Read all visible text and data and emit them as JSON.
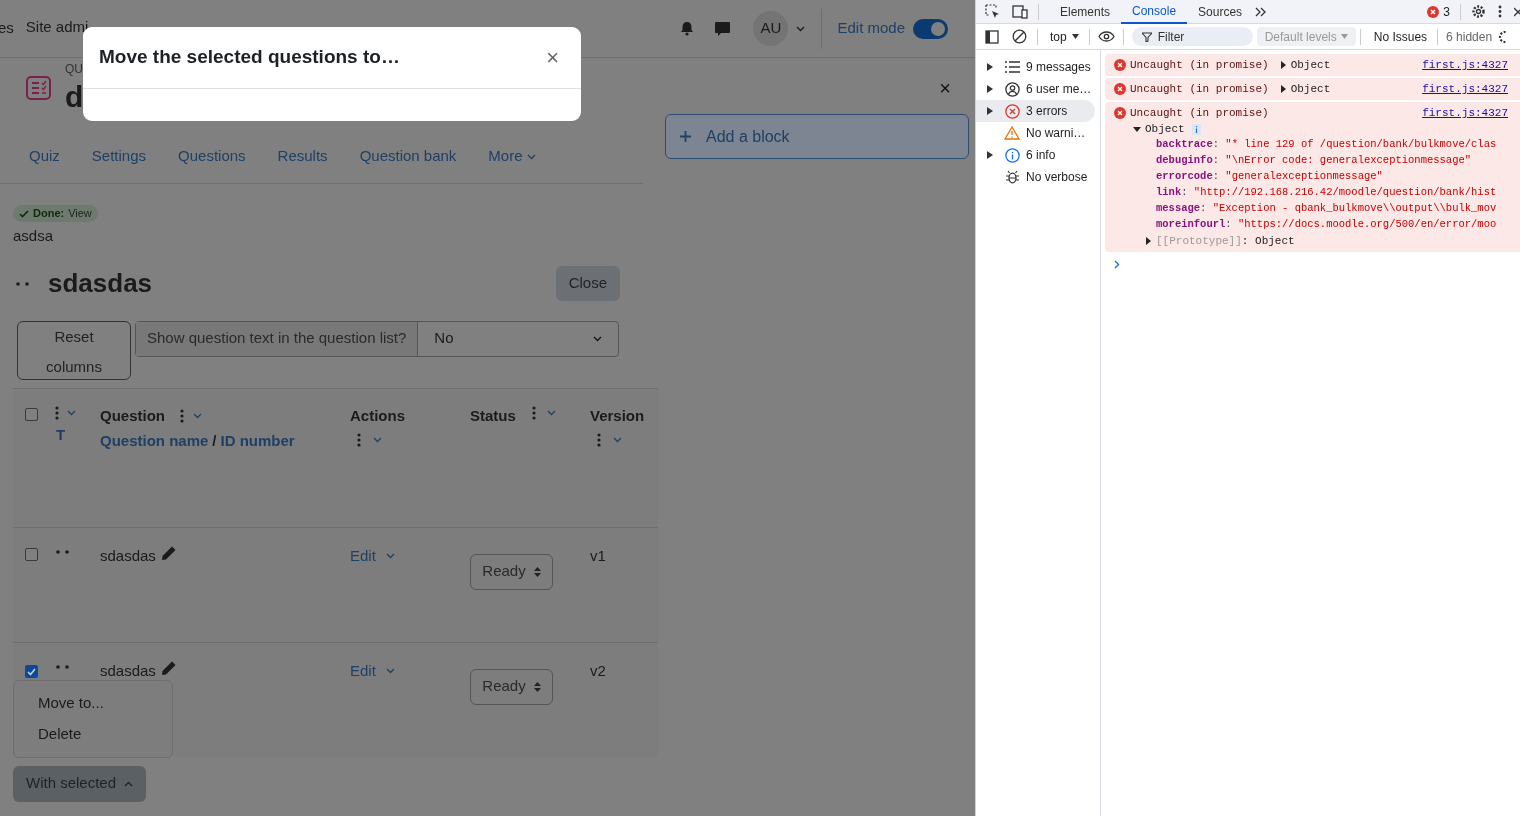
{
  "header": {
    "nav_items": [
      "es",
      "Site admi"
    ],
    "avatar": "AU",
    "edit_mode": {
      "label": "Edit mode",
      "on": true
    }
  },
  "modal": {
    "title": "Move the selected questions to…",
    "close": "×"
  },
  "page_header": {
    "kicker": "QU",
    "title": "d"
  },
  "tabs": [
    {
      "label": "Quiz"
    },
    {
      "label": "Settings"
    },
    {
      "label": "Questions"
    },
    {
      "label": "Results"
    },
    {
      "label": "Question bank"
    },
    {
      "label": "More",
      "dropdown": true
    }
  ],
  "completion": {
    "label": "Done:",
    "action": "View"
  },
  "description": "asdsa",
  "category": {
    "title": "sdasdas",
    "close": "Close"
  },
  "reset_columns": "Reset columns",
  "show_text": {
    "label": "Show question text in the question list?",
    "value": "No"
  },
  "table": {
    "select_all_checked": false,
    "columns": [
      {
        "kind": "type",
        "sort_label": "T"
      },
      {
        "kind": "question",
        "label": "Question",
        "sort_links": [
          "Question name",
          "ID number"
        ],
        "separator": "/"
      },
      {
        "kind": "actions",
        "label": "Actions"
      },
      {
        "kind": "status",
        "label": "Status"
      },
      {
        "kind": "version",
        "label": "Version"
      }
    ],
    "rows": [
      {
        "checked": false,
        "name": "sdasdas",
        "action": "Edit",
        "status": "Ready",
        "version": "v1"
      },
      {
        "checked": true,
        "name": "sdasdas",
        "action": "Edit",
        "status": "Ready",
        "version": "v2"
      }
    ]
  },
  "bulk_menu": {
    "items": [
      "Move to...",
      "Delete"
    ],
    "button": "With selected",
    "expanded": true
  },
  "blocks": {
    "close": "×",
    "add": "Add a block"
  },
  "devtools": {
    "tabs": [
      {
        "label": "Elements",
        "selected": false
      },
      {
        "label": "Console",
        "selected": true
      },
      {
        "label": "Sources",
        "selected": false
      }
    ],
    "error_count": "3",
    "context": "top",
    "filter_placeholder": "Filter",
    "levels": "Default levels",
    "issues": "No Issues",
    "hidden": "6 hidden",
    "sidebar": [
      {
        "kind": "messages",
        "label": "9 messages",
        "expandable": true,
        "selected": false
      },
      {
        "kind": "user",
        "label": "6 user me…",
        "expandable": true,
        "selected": false
      },
      {
        "kind": "error",
        "label": "3 errors",
        "expandable": true,
        "selected": true
      },
      {
        "kind": "warning",
        "label": "No warni…",
        "expandable": false,
        "selected": false
      },
      {
        "kind": "info",
        "label": "6 info",
        "expandable": true,
        "selected": false
      },
      {
        "kind": "verbose",
        "label": "No verbose",
        "expandable": false,
        "selected": false
      }
    ],
    "messages": [
      {
        "text": "Uncaught (in promise)",
        "object": "Object",
        "expanded": false,
        "source": "first.js:4327"
      },
      {
        "text": "Uncaught (in promise)",
        "object": "Object",
        "expanded": false,
        "source": "first.js:4327"
      },
      {
        "text": "Uncaught (in promise)",
        "object": "Object",
        "expanded": true,
        "source": "first.js:4327",
        "separator": ":",
        "properties": [
          {
            "key": "backtrace",
            "value": "\"* line 129 of /question/bank/bulkmove/clas"
          },
          {
            "key": "debuginfo",
            "value": "\"\\nError code: generalexceptionmessage\""
          },
          {
            "key": "errorcode",
            "value": "\"generalexceptionmessage\""
          },
          {
            "key": "link",
            "value": "\"http://192.168.216.42/moodle/question/bank/hist"
          },
          {
            "key": "message",
            "value": "\"Exception - qbank_bulkmove\\\\output\\\\bulk_mov"
          },
          {
            "key": "moreinfourl",
            "value": "\"https://docs.moodle.org/500/en/error/moo"
          }
        ],
        "prototype_key": "[[Prototype]]",
        "prototype_value": "Object"
      }
    ]
  }
}
